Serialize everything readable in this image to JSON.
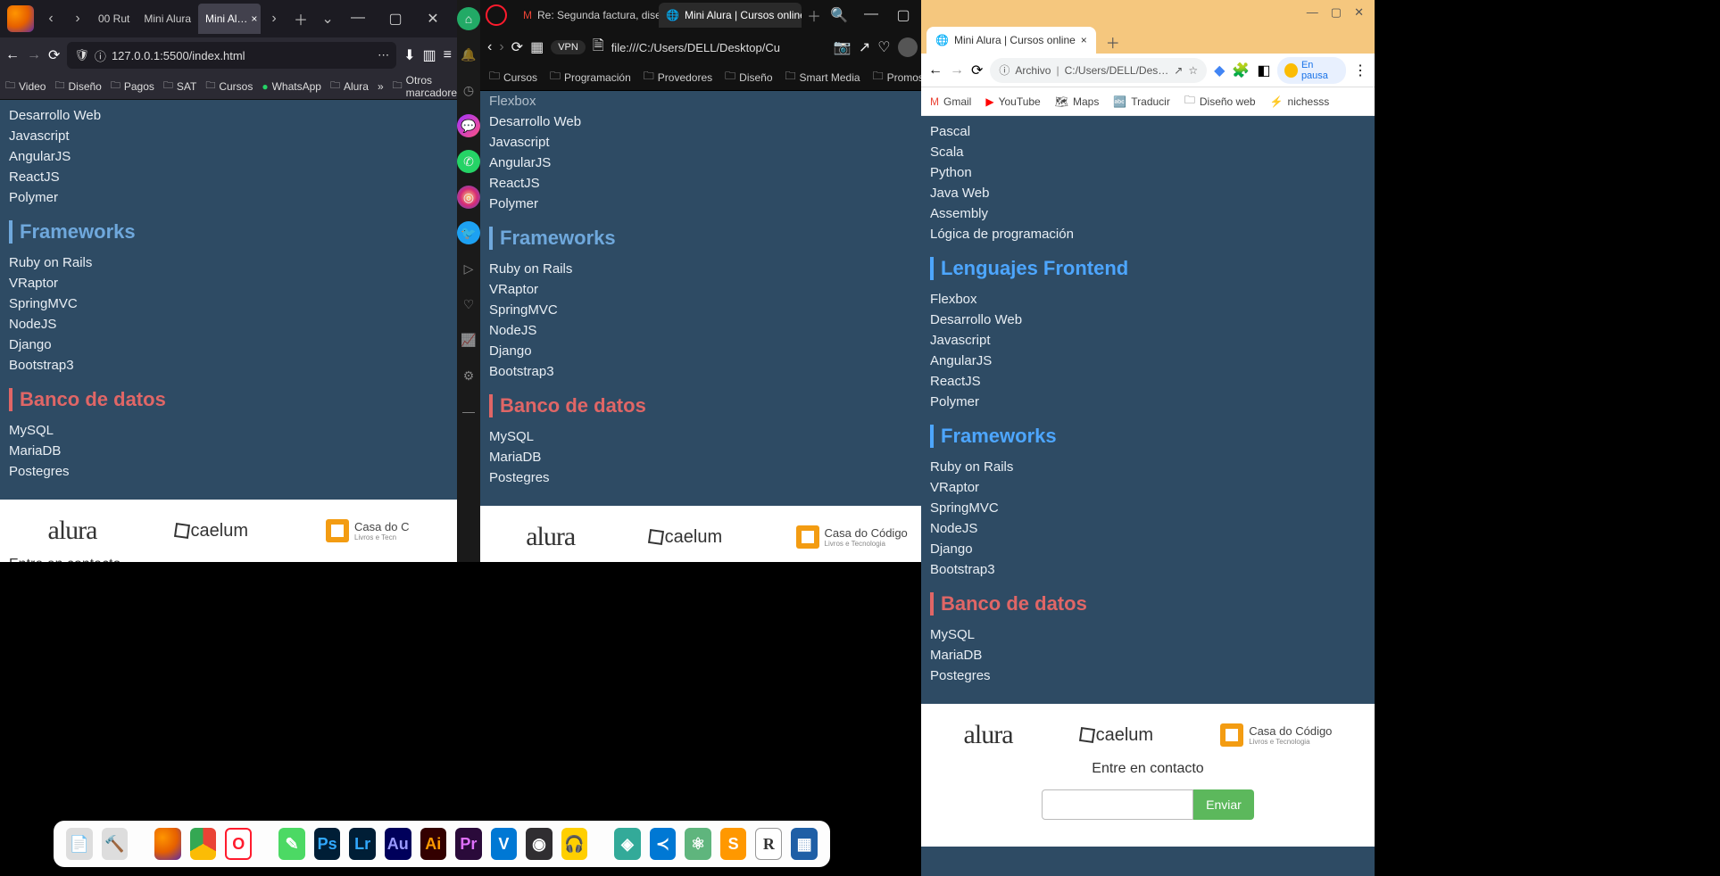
{
  "firefox": {
    "tabs": [
      "",
      "00 Rut",
      "Mini Alura",
      "Mini Al…"
    ],
    "url": "127.0.0.1:5500/index.html",
    "bookmarks": [
      "Video",
      "Diseño",
      "Pagos",
      "SAT",
      "Cursos",
      "WhatsApp",
      "Alura"
    ],
    "more_bookmarks": "Otros marcadores"
  },
  "opera": {
    "tabs": [
      "Re: Segunda factura, diseñ…",
      "Mini Alura | Cursos online"
    ],
    "vpn": "VPN",
    "url": "file:///C:/Users/DELL/Desktop/Cu",
    "bookmarks": [
      "Cursos",
      "Programación",
      "Provedores",
      "Diseño",
      "Smart Media",
      "Promos"
    ]
  },
  "chrome": {
    "tab": "Mini Alura | Cursos online",
    "url_prefix": "Archivo",
    "url": "C:/Users/DELL/Des…",
    "pause": "En pausa",
    "bookmarks": [
      "Gmail",
      "YouTube",
      "Maps",
      "Traducir",
      "Diseño web",
      "nichesss"
    ]
  },
  "content": {
    "langs_backend_extra": [
      "Pascal",
      "Scala",
      "Python",
      "Java Web",
      "Assembly",
      "Lógica de programación"
    ],
    "h_lenguajes": "Lenguajes Frontend",
    "langs_frontend": [
      "Flexbox",
      "Desarrollo Web",
      "Javascript",
      "AngularJS",
      "ReactJS",
      "Polymer"
    ],
    "langs_frontend_ff": [
      "Desarrollo Web",
      "Javascript",
      "AngularJS",
      "ReactJS",
      "Polymer"
    ],
    "h_frameworks": "Frameworks",
    "frameworks": [
      "Ruby on Rails",
      "VRaptor",
      "SpringMVC",
      "NodeJS",
      "Django",
      "Bootstrap3"
    ],
    "h_banco": "Banco de datos",
    "bancos": [
      "MySQL",
      "MariaDB",
      "Postegres"
    ],
    "logo_alura": "alura",
    "logo_caelum": "caelum",
    "logo_casa": "Casa do Código",
    "logo_casa_sub": "Livros e Tecnologia",
    "logo_casa_short": "Casa do C",
    "logo_casa_short_sub": "Livros e Tecn",
    "contact": "Entre en contacto",
    "send": "Enviar"
  },
  "dock": [
    "txt",
    "xc",
    "ff",
    "ch",
    "op",
    "",
    "green",
    "ps",
    "lr",
    "au",
    "ai",
    "pr",
    "vs",
    "obs",
    "aud",
    "",
    "green2",
    "vscode",
    "at",
    "sub",
    "r",
    "vb"
  ]
}
